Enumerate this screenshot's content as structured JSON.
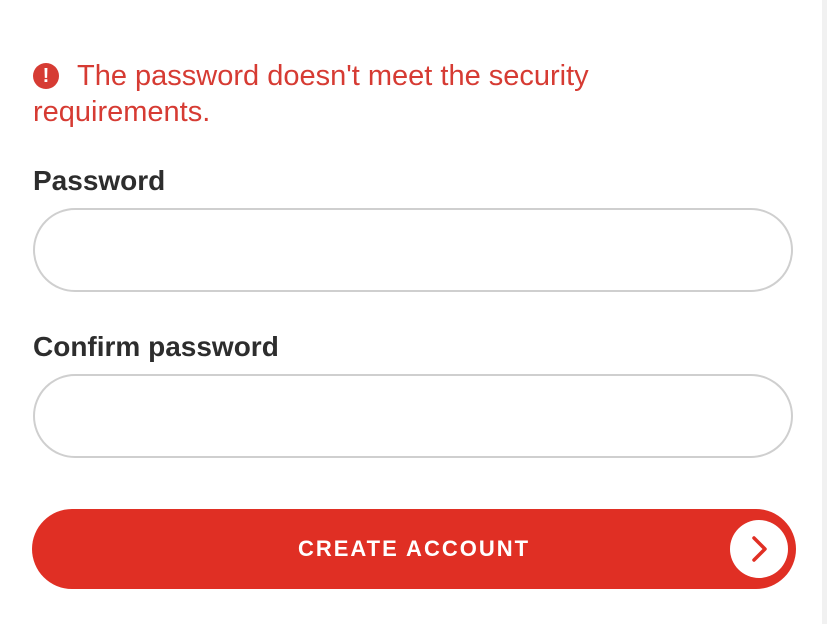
{
  "error": {
    "icon": "alert-circle-icon",
    "icon_glyph": "!",
    "message": "The password doesn't meet the security requirements."
  },
  "form": {
    "password_label": "Password",
    "password_value": "",
    "confirm_label": "Confirm password",
    "confirm_value": ""
  },
  "submit": {
    "label": "CREATE ACCOUNT",
    "icon": "chevron-right-icon"
  },
  "colors": {
    "error": "#d63b33",
    "primary": "#e02f24",
    "label": "#2d2d2d",
    "field_border": "#cfcfcf"
  }
}
